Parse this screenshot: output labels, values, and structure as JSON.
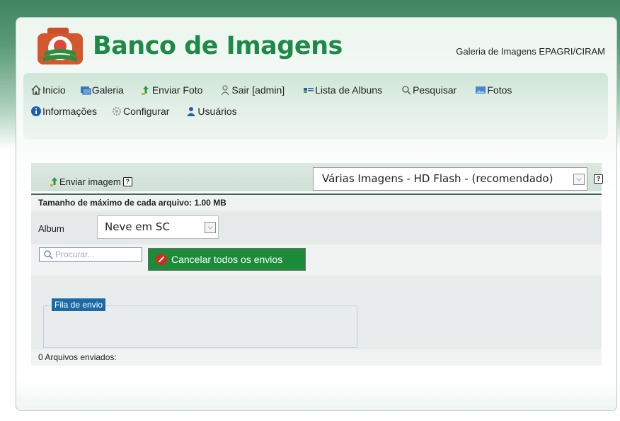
{
  "header": {
    "brand": "Banco de Imagens",
    "subtitle": "Galeria de Imagens EPAGRI/CIRAM"
  },
  "nav": {
    "row1": [
      {
        "label": "Inicio",
        "icon": "home-icon"
      },
      {
        "label": "Galeria",
        "icon": "gallery-icon"
      },
      {
        "label": "Enviar Foto",
        "icon": "upload-icon"
      },
      {
        "label": "Sair [admin]",
        "icon": "logout-icon"
      },
      {
        "label": "Lista de Albuns",
        "icon": "list-icon"
      },
      {
        "label": "Pesquisar",
        "icon": "search-icon"
      },
      {
        "label": "Fotos",
        "icon": "photos-icon"
      }
    ],
    "row2": [
      {
        "label": "Informações",
        "icon": "info-icon"
      },
      {
        "label": "Configurar",
        "icon": "gear-icon"
      },
      {
        "label": "Usuários",
        "icon": "users-icon"
      }
    ]
  },
  "upload": {
    "title": "Enviar imagem",
    "help": "?",
    "mode_value": "Várias Imagens - HD Flash - (recomendado)",
    "max_size_label": "Tamanho de máximo de cada arquivo: 1.00 MB",
    "album_label": "Album",
    "album_value": "Neve em SC",
    "search_placeholder": "Procurar...",
    "cancel_label": "Cancelar todos os envios",
    "queue_label": "Fila de envio",
    "sent_label": "0 Arquivos enviados:"
  },
  "colors": {
    "brand_green": "#1d8a46",
    "button_green": "#1c8c3b",
    "queue_blue": "#1a6aa5"
  }
}
